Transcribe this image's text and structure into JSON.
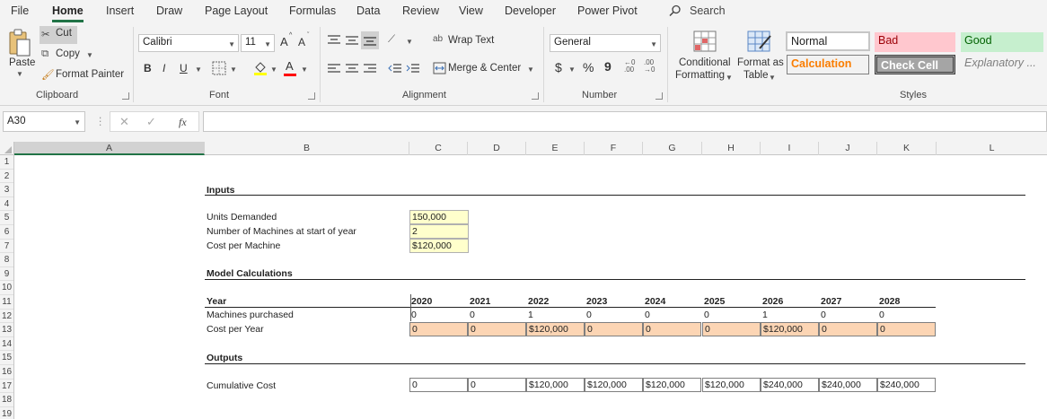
{
  "menu": {
    "tabs": [
      "File",
      "Home",
      "Insert",
      "Draw",
      "Page Layout",
      "Formulas",
      "Data",
      "Review",
      "View",
      "Developer",
      "Power Pivot"
    ],
    "active": "Home",
    "search": "Search"
  },
  "ribbon": {
    "clipboard": {
      "paste": "Paste",
      "cut": "Cut",
      "copy": "Copy",
      "format_painter": "Format Painter",
      "label": "Clipboard"
    },
    "font": {
      "family": "Calibri",
      "size": "11",
      "grow": "A",
      "shrink": "A",
      "bold": "B",
      "italic": "I",
      "underline": "U",
      "font_color_letter": "A",
      "label": "Font",
      "font_color": "#ff0000",
      "highlight_color": "#ffff00"
    },
    "alignment": {
      "wrap_text": "Wrap Text",
      "merge_center": "Merge & Center",
      "label": "Alignment"
    },
    "number": {
      "format": "General",
      "currency": "$",
      "percent": "%",
      "comma": "9",
      "label": "Number"
    },
    "styles": {
      "conditional_formatting": [
        "Conditional",
        "Formatting"
      ],
      "format_as_table": [
        "Format as",
        "Table"
      ],
      "cells": {
        "normal": "Normal",
        "bad": "Bad",
        "good": "Good",
        "calculation": "Calculation",
        "check_cell": "Check Cell",
        "explanatory": "Explanatory ..."
      },
      "label": "Styles"
    }
  },
  "formula_bar": {
    "name_box": "A30",
    "fx": "fx",
    "formula": ""
  },
  "columns": [
    "A",
    "B",
    "C",
    "D",
    "E",
    "F",
    "G",
    "H",
    "I",
    "J",
    "K",
    "L"
  ],
  "rows": [
    "1",
    "2",
    "3",
    "4",
    "5",
    "6",
    "7",
    "8",
    "9",
    "10",
    "11",
    "12",
    "13",
    "14",
    "15",
    "16",
    "17",
    "18",
    "19"
  ],
  "sheet": {
    "inputs_header": "Inputs",
    "units_demanded_label": "Units Demanded",
    "units_demanded_value": "150,000",
    "machines_start_label": "Number of Machines at start of year",
    "machines_start_value": "2",
    "cost_per_machine_label": "Cost per Machine",
    "cost_per_machine_value": "$120,000",
    "model_header": "Model Calculations",
    "year_label": "Year",
    "years": [
      "2020",
      "2021",
      "2022",
      "2023",
      "2024",
      "2025",
      "2026",
      "2027",
      "2028"
    ],
    "machines_purchased_label": "Machines purchased",
    "machines_purchased": [
      "0",
      "0",
      "1",
      "0",
      "0",
      "0",
      "1",
      "0",
      "0"
    ],
    "cost_per_year_label": "Cost per Year",
    "cost_per_year": [
      "0",
      "0",
      "$120,000",
      "0",
      "0",
      "0",
      "$120,000",
      "0",
      "0"
    ],
    "outputs_header": "Outputs",
    "cumulative_cost_label": "Cumulative Cost",
    "cumulative_cost": [
      "0",
      "0",
      "$120,000",
      "$120,000",
      "$120,000",
      "$120,000",
      "$240,000",
      "$240,000",
      "$240,000"
    ]
  },
  "colors": {
    "accent": "#217346",
    "input_fill": "#ffffcc",
    "calc_fill": "#fcd5b4",
    "bad_fill": "#ffc7ce",
    "bad_text": "#9c0006",
    "good_fill": "#c6efce",
    "good_text": "#006100",
    "calc_text": "#fa7d00",
    "check_fill": "#a5a5a5"
  }
}
